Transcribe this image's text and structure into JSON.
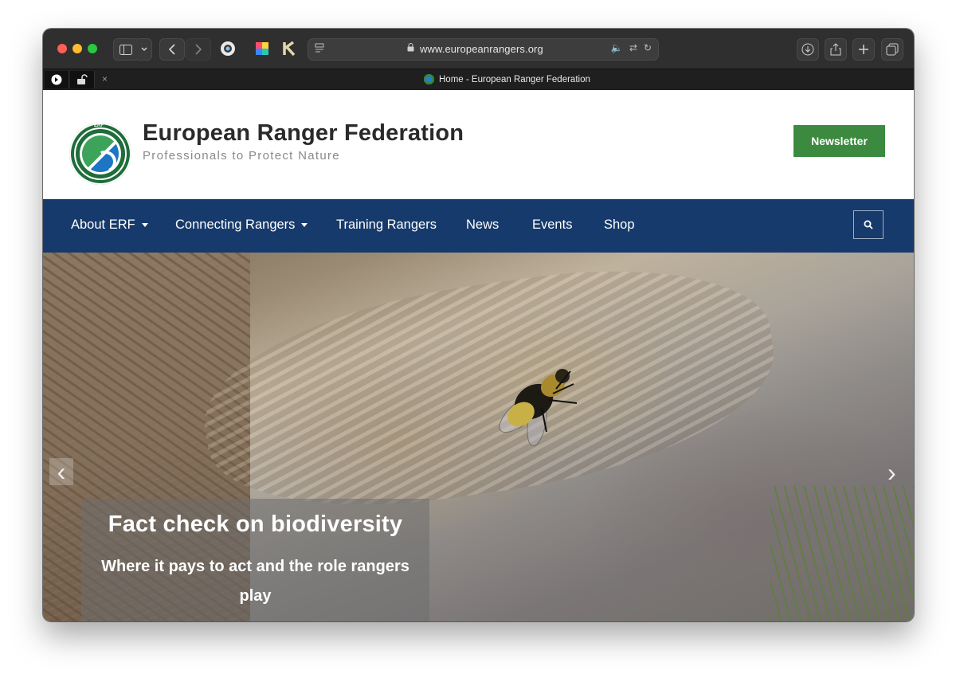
{
  "browser": {
    "url": "www.europeanrangers.org",
    "tab_title": "Home - European Ranger Federation",
    "tab_close": "×",
    "colors": {
      "red": "#fe5f57",
      "yellow": "#febc2e",
      "green": "#28c840",
      "speaker": "#4da3ff"
    },
    "icons": [
      "sidebar-icon",
      "chevron-down-icon",
      "back-icon",
      "forward-icon",
      "extension-icon",
      "extension-color-icon",
      "k-icon",
      "reader-icon",
      "lock-icon",
      "speaker-icon",
      "translate-icon",
      "reload-icon",
      "download-icon",
      "share-icon",
      "plus-icon",
      "tabs-overview-icon"
    ]
  },
  "site": {
    "title": "European Ranger Federation",
    "tagline": "Professionals to Protect Nature",
    "logo_text": "ERF",
    "newsletter_label": "Newsletter",
    "colors": {
      "nav": "#163a6b",
      "newsletter": "#3c8a40",
      "logo": "#1f6d3a"
    }
  },
  "nav": {
    "items": [
      {
        "label": "About ERF",
        "dropdown": true
      },
      {
        "label": "Connecting Rangers",
        "dropdown": true
      },
      {
        "label": "Training Rangers",
        "dropdown": false
      },
      {
        "label": "News",
        "dropdown": false
      },
      {
        "label": "Events",
        "dropdown": false
      },
      {
        "label": "Shop",
        "dropdown": false
      }
    ]
  },
  "hero": {
    "title": "Fact check on biodiversity",
    "subtitle": "Where it pays to act and the role rangers play",
    "prev_arrow": "‹",
    "next_arrow": "›"
  }
}
